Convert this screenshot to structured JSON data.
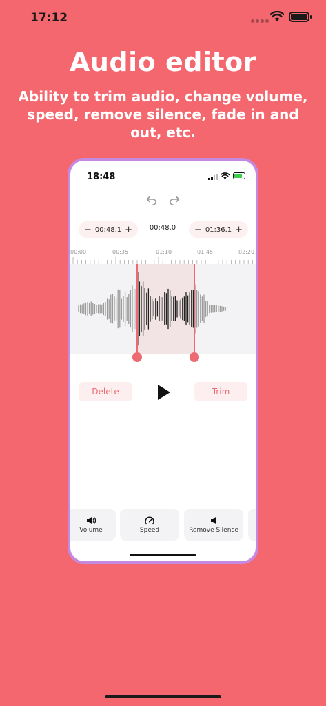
{
  "status_bar": {
    "time": "17:12"
  },
  "hero": {
    "title": "Audio editor",
    "subtitle": "Ability to trim audio, change volume, speed, remove silence, fade in and out, etc."
  },
  "phone": {
    "status_time": "18:48",
    "start_time": {
      "minus": "−",
      "value": "00:48.1",
      "plus": "+"
    },
    "duration": "00:48.0",
    "end_time": {
      "minus": "−",
      "value": "01:36.1",
      "plus": "+"
    },
    "ruler_labels": [
      "00:00",
      "00:35",
      "01:10",
      "01:45",
      "02:20"
    ],
    "selection": {
      "start_fraction": 0.36,
      "end_fraction": 0.67
    },
    "actions": {
      "delete": "Delete",
      "trim": "Trim"
    },
    "tools": [
      {
        "label": "Volume",
        "icon": "speaker-icon"
      },
      {
        "label": "Speed",
        "icon": "speedometer-icon"
      },
      {
        "label": "Remove Silence",
        "icon": "speaker-muted-icon"
      }
    ]
  },
  "colors": {
    "background": "#F4676E",
    "accent": "#EE6A72",
    "phone_border": "#C58AE0"
  }
}
